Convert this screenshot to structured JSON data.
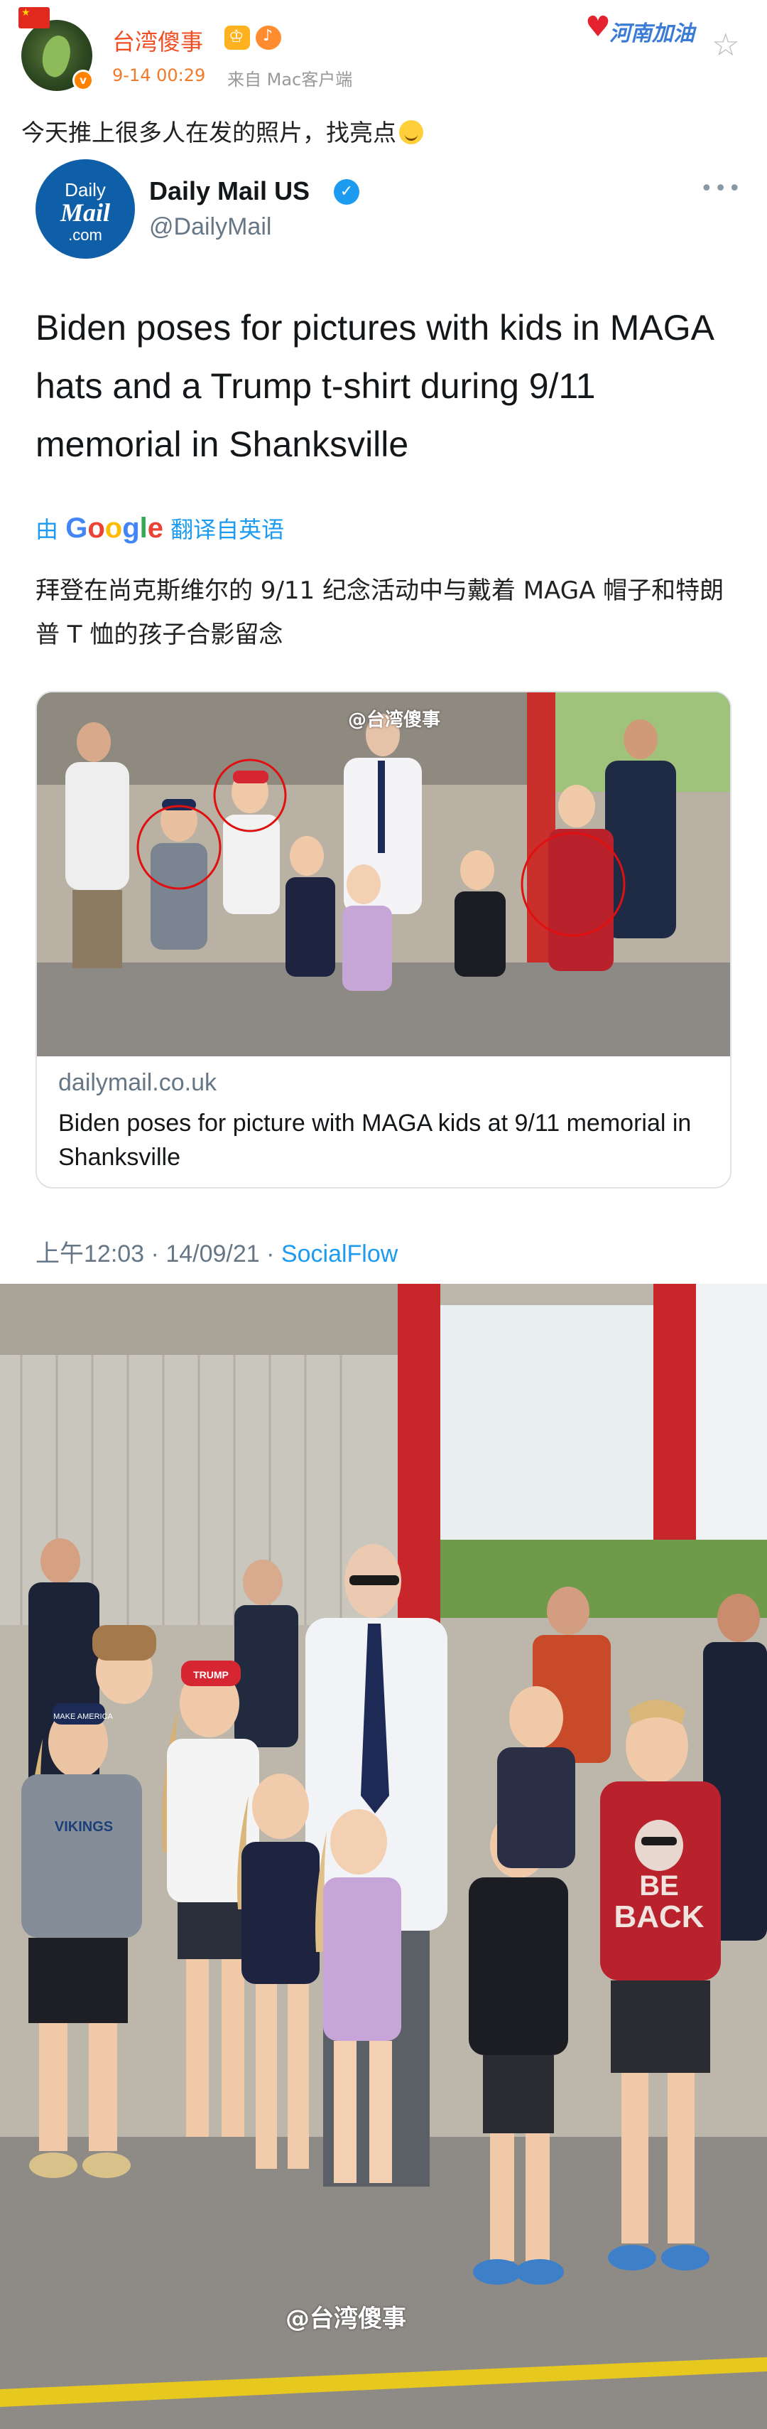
{
  "post": {
    "user_name": "台湾傻事",
    "time": "9-14 00:29",
    "source": "来自 Mac客户端",
    "henan_badge": "河南加油",
    "text": "今天推上很多人在发的照片，找亮点"
  },
  "tweet": {
    "logo": {
      "line1": "Daily",
      "line2": "Mail",
      "line3": ".com"
    },
    "account_name": "Daily Mail US",
    "handle": "@DailyMail",
    "more": "•••",
    "headline": "Biden poses for pictures with kids in MAGA hats and a Trump t-shirt during 9/11 memorial in Shanksville",
    "translate": {
      "prefix": "由",
      "google": "Google",
      "suffix": "翻译自英语"
    },
    "translated_text": "拜登在尚克斯维尔的 9/11 纪念活动中与戴着 MAGA 帽子和特朗普 T 恤的孩子合影留念",
    "card": {
      "domain": "dailymail.co.uk",
      "title": "Biden poses for picture with MAGA kids at 9/11 memorial in Shanksville",
      "watermark": "@台湾傻事"
    },
    "meta": {
      "time": "上午12:03",
      "sep": "·",
      "date": "14/09/21",
      "source": "SocialFlow"
    }
  },
  "photo": {
    "watermark": "@台湾傻事",
    "hat_text_trump": "TRUMP",
    "hat_text_maga": "MAKE AMERICA GREAT AGAIN",
    "shirt_text": "BE BACK",
    "shirt_text_vikings": "VIKINGS"
  },
  "colors": {
    "weibo_orange": "#f04f24",
    "twitter_blue": "#1d9bf0",
    "circle_red": "#e01010"
  }
}
